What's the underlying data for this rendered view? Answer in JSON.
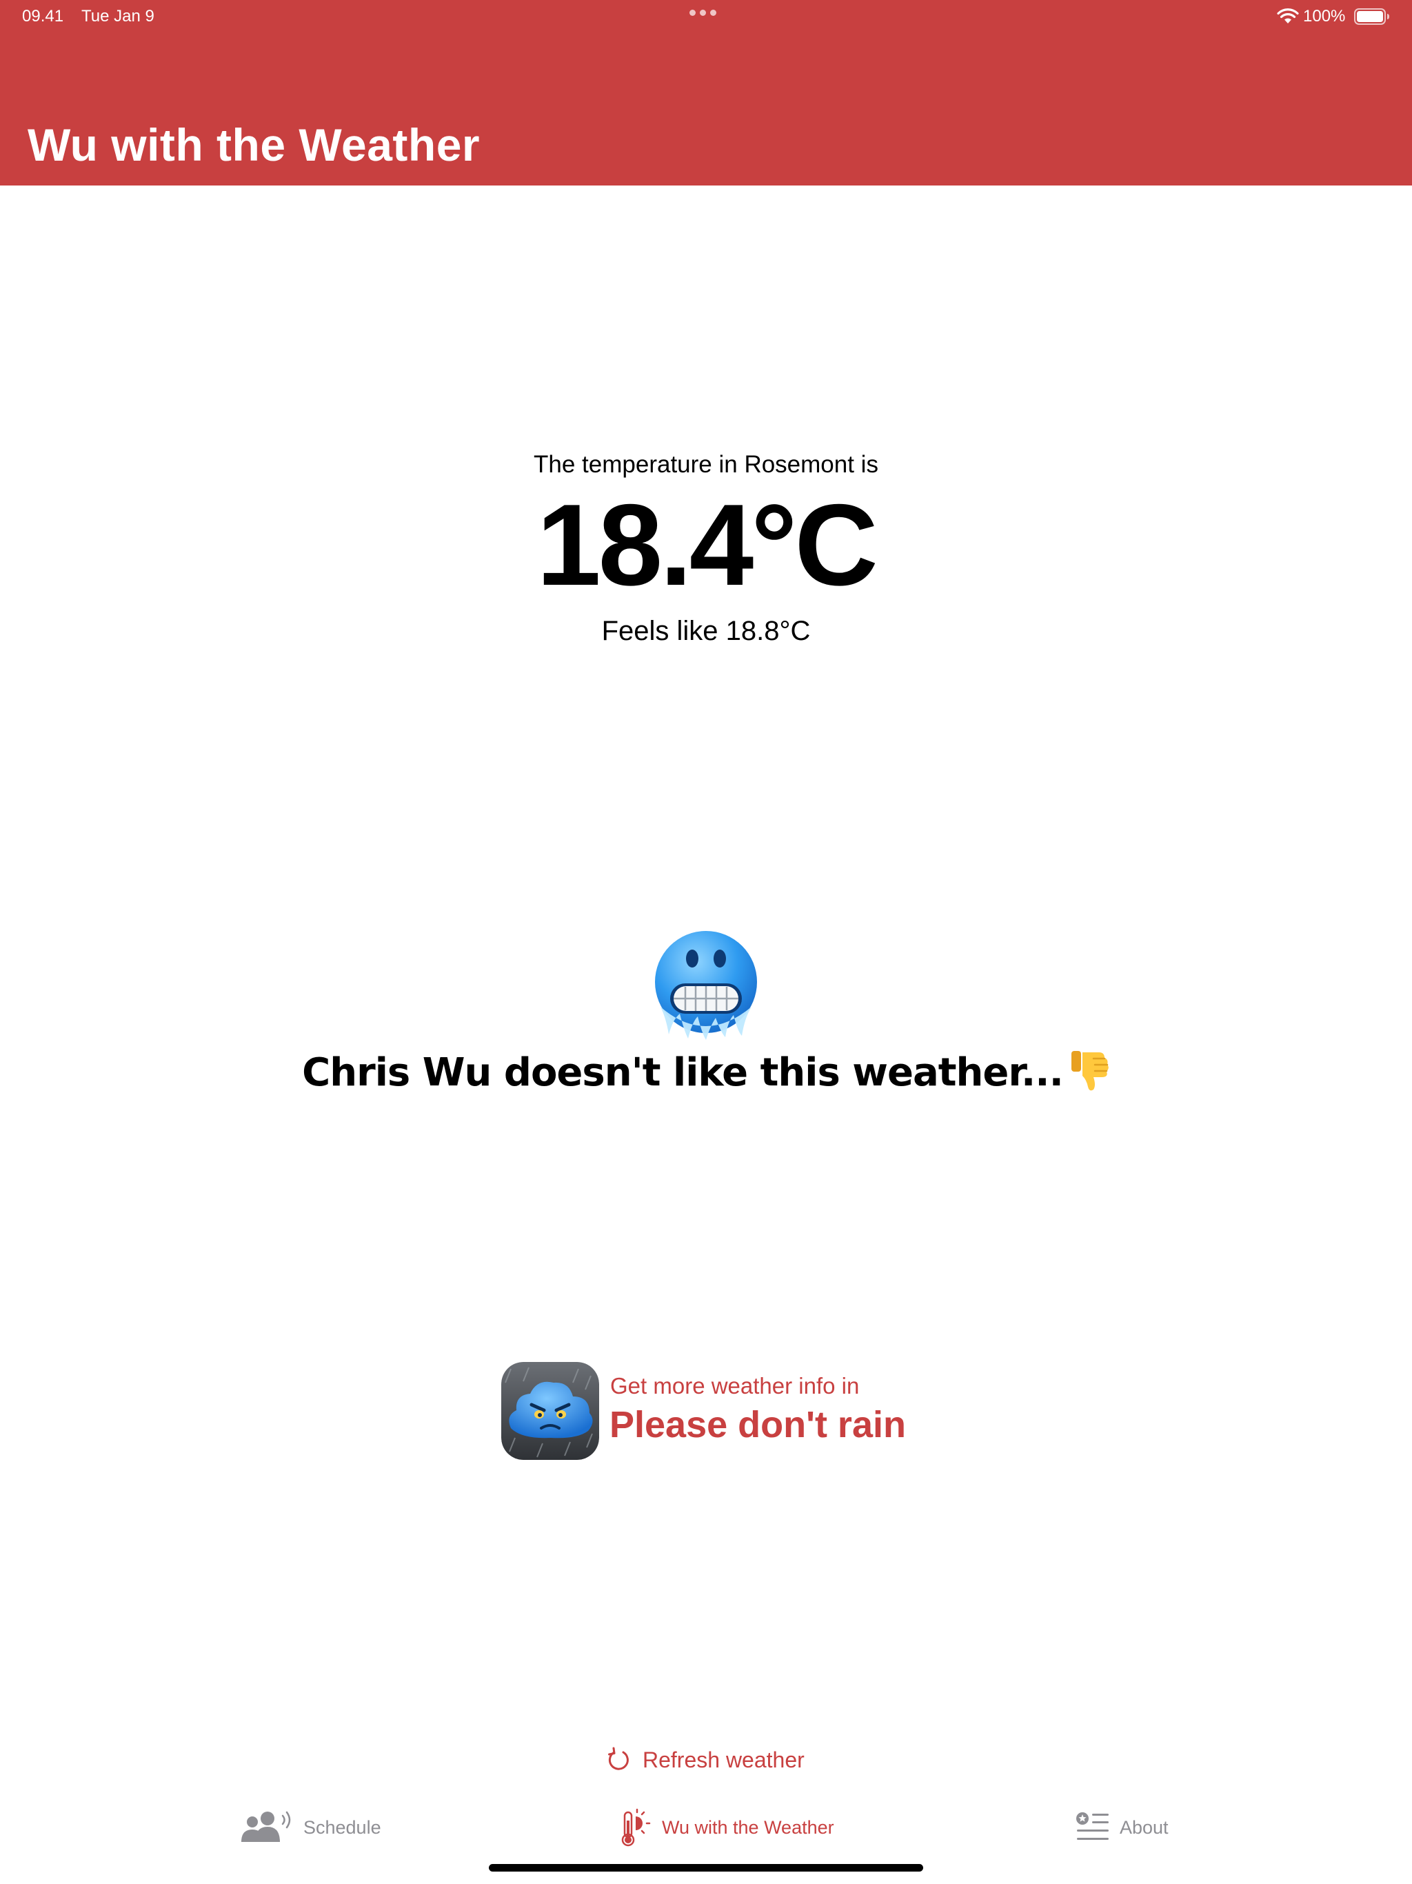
{
  "status_bar": {
    "time": "09.41",
    "date": "Tue Jan 9",
    "battery": "100%",
    "icons": [
      "wifi-icon",
      "battery-icon"
    ]
  },
  "header": {
    "title": "Wu with the Weather",
    "background_color": "#c84040"
  },
  "weather": {
    "caption": "The temperature in Rosemont is",
    "temperature": "18.4°C",
    "feels_like": "Feels like 18.8°C",
    "mood_icon": "cold-face-icon",
    "verdict": "Chris Wu doesn't like this weather...",
    "verdict_icon": "thumbs-down-icon"
  },
  "promo": {
    "caption": "Get more weather info in",
    "app_name": "Please don't rain",
    "icon": "angry-cloud-app-icon"
  },
  "refresh": {
    "label": "Refresh weather",
    "icon": "refresh-icon"
  },
  "tabs": [
    {
      "label": "Schedule",
      "icon": "people-broadcast-icon",
      "active": false
    },
    {
      "label": "Wu with the Weather",
      "icon": "thermometer-sun-icon",
      "active": true
    },
    {
      "label": "About",
      "icon": "list-star-icon",
      "active": false
    }
  ],
  "colors": {
    "accent": "#c84040",
    "inactive_tab": "#8e8e93",
    "text": "#000000"
  }
}
